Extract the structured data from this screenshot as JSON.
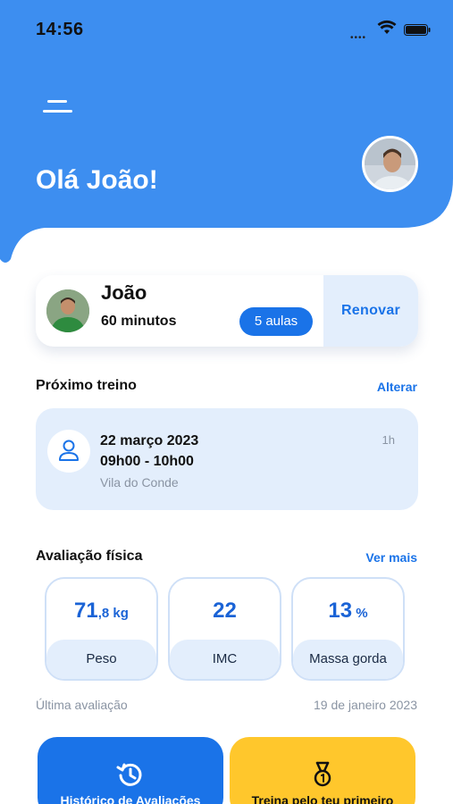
{
  "status_bar": {
    "time": "14:56",
    "signal_dots": "••••"
  },
  "header": {
    "greeting": "Olá João!"
  },
  "member": {
    "name": "João",
    "minutes": "60 minutos",
    "classes_badge": "5 aulas",
    "renew_label": "Renovar"
  },
  "next_training": {
    "title": "Próximo treino",
    "change_label": "Alterar",
    "date": "22 março 2023",
    "time": "09h00 - 10h00",
    "location": "Vila do Conde",
    "duration": "1h"
  },
  "assessment": {
    "title": "Avaliação física",
    "more_label": "Ver mais",
    "metrics": [
      {
        "value_main": "71",
        "value_suffix": ",8 kg",
        "label": "Peso"
      },
      {
        "value_main": "22",
        "value_suffix": "",
        "label": "IMC"
      },
      {
        "value_main": "13",
        "value_suffix": " %",
        "label": "Massa gorda"
      }
    ],
    "last_label": "Última avaliação",
    "last_date": "19 de janeiro 2023"
  },
  "tiles": {
    "history_label": "Histórico de Avaliações",
    "first_label": "Treina pelo teu primeiro"
  },
  "colors": {
    "primary": "#1a73e8",
    "header": "#3d8ef0",
    "light": "#e3eefc",
    "yellow": "#ffc72c"
  }
}
